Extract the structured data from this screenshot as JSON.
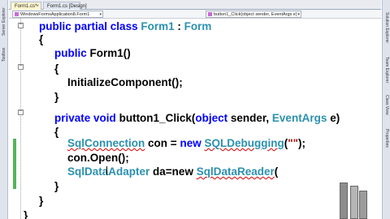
{
  "tabs": [
    {
      "label": "Form1.cs*",
      "active": true
    },
    {
      "label": "Form1.cs [Design]",
      "active": false
    }
  ],
  "nav": {
    "class_dropdown": "WindowsFormsApplication8.Form1",
    "member_dropdown": "button1_Click(object sender, EventArgs e)"
  },
  "left_dock": [
    "Server Explorer",
    "Toolbox"
  ],
  "right_dock": [
    "Solution Explorer",
    "Team Explorer",
    "Class View",
    "Properties"
  ],
  "code": {
    "l1": [
      "public",
      "partial",
      "class",
      "Form1",
      ":",
      "Form"
    ],
    "l2": "{",
    "l3": [
      "public",
      "Form1()"
    ],
    "l4": "{",
    "l5": "InitializeComponent();",
    "l6": "}",
    "l7": [
      "private",
      "void",
      "button1_Click(",
      "object",
      "sender,",
      "EventArgs",
      "e)"
    ],
    "l8": "{",
    "l9": [
      "SqlConnection",
      "con",
      "=",
      "new",
      "SQLDebugging",
      "(",
      "\"\"",
      ");"
    ],
    "l10": "con.Open();",
    "l11": [
      "SqlDataAdapter",
      "da=new",
      "SqlDataReader",
      "("
    ],
    "l12": "}",
    "l13": "}",
    "l14": "}"
  },
  "colors": {
    "keyword": "#0000ff",
    "type": "#2b91af",
    "string": "#a31515",
    "error_squiggle": "#d40000",
    "change_bar": "#56b35a"
  }
}
